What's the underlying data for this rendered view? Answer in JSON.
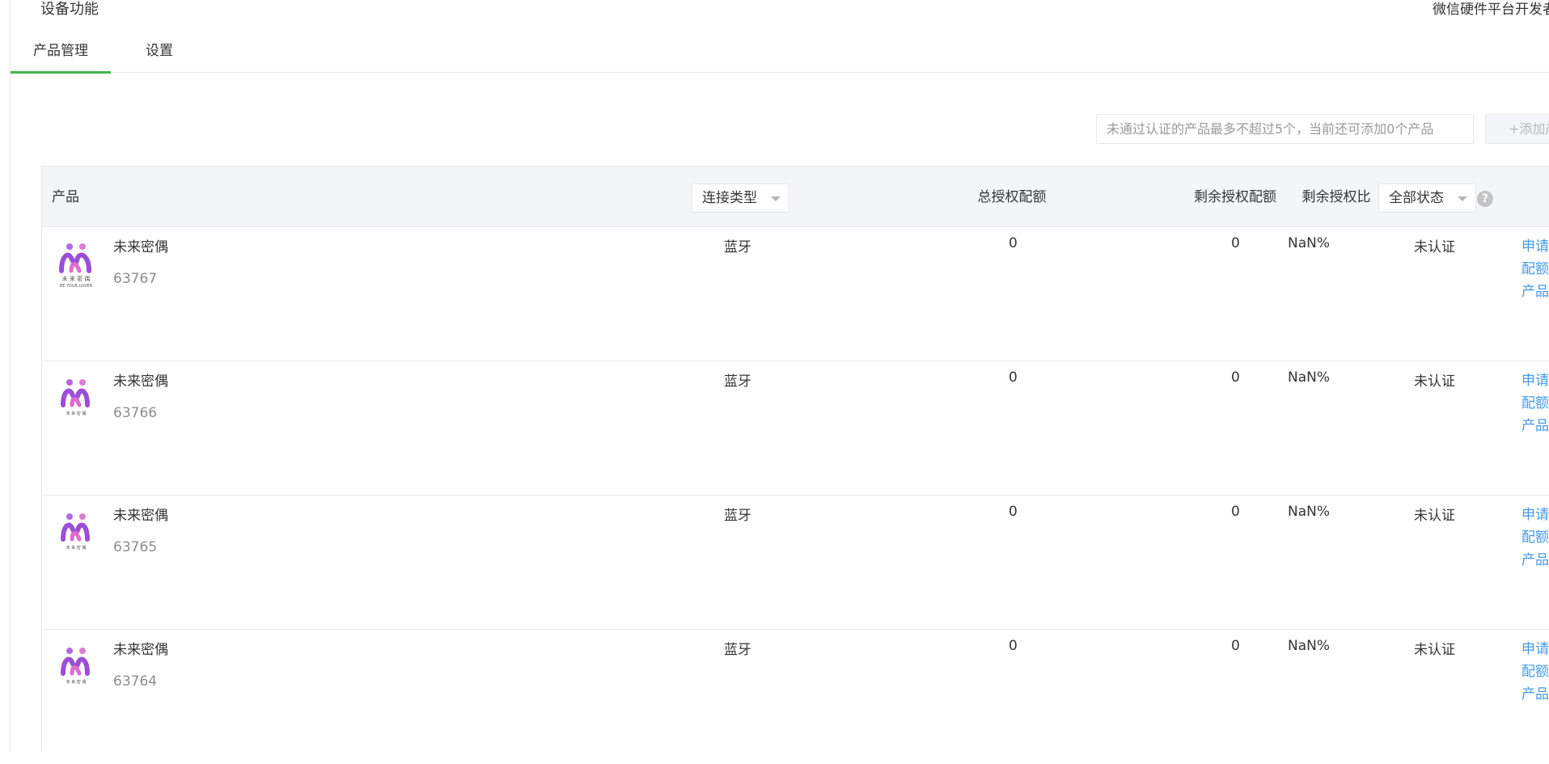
{
  "header": {
    "title": "设备功能",
    "right_link": "微信硬件平台开发者"
  },
  "tabs": [
    {
      "label": "产品管理",
      "active": true
    },
    {
      "label": "设置",
      "active": false
    }
  ],
  "toolbar": {
    "notice": "未通过认证的产品最多不超过5个，当前还可添加0个产品",
    "add_label": "+添加产品"
  },
  "table": {
    "headers": {
      "product": "产品",
      "connection_type": "连接类型",
      "total_quota": "总授权配额",
      "remaining_quota": "剩余授权配额",
      "remaining_ratio": "剩余授权比",
      "status_filter": "全部状态",
      "help": "?"
    },
    "rows": [
      {
        "name": "未来密偶",
        "id": "63767",
        "connection": "蓝牙",
        "total": "0",
        "remaining": "0",
        "ratio": "NaN%",
        "status": "未认证",
        "actions": [
          "申请",
          "配额",
          "产品"
        ]
      },
      {
        "name": "未来密偶",
        "id": "63766",
        "connection": "蓝牙",
        "total": "0",
        "remaining": "0",
        "ratio": "NaN%",
        "status": "未认证",
        "actions": [
          "申请",
          "配额",
          "产品"
        ]
      },
      {
        "name": "未来密偶",
        "id": "63765",
        "connection": "蓝牙",
        "total": "0",
        "remaining": "0",
        "ratio": "NaN%",
        "status": "未认证",
        "actions": [
          "申请",
          "配额",
          "产品"
        ]
      },
      {
        "name": "未来密偶",
        "id": "63764",
        "connection": "蓝牙",
        "total": "0",
        "remaining": "0",
        "ratio": "NaN%",
        "status": "未认证",
        "actions": [
          "申请",
          "配额",
          "产品"
        ]
      }
    ]
  },
  "logo": {
    "caption_cn": "未 来 密 偶",
    "caption_en": "BE YOUR LOVER"
  },
  "colors": {
    "accent_green": "#44b549",
    "link_blue": "#459ae9",
    "logo_purple": "#9b4fd6",
    "logo_pink": "#e06bd0"
  }
}
